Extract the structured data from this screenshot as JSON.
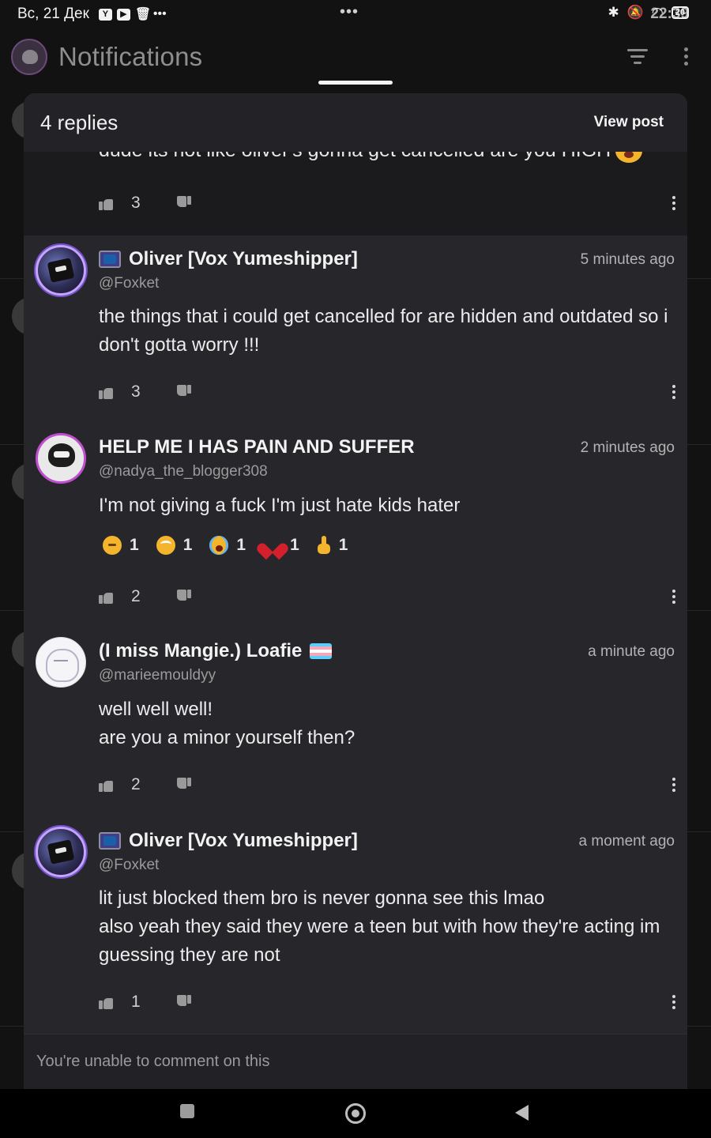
{
  "status_bar": {
    "time": "22:39",
    "date": "Вс, 21 Дек",
    "battery": "20"
  },
  "app": {
    "title": "Notifications"
  },
  "sheet": {
    "title": "4 replies",
    "view_post": "View post",
    "cropped_parent_text": "dude its not like oliver's gonna get cancelled are you HIGH",
    "parent_votes": "3",
    "unable_to_comment": "You're unable to comment on this"
  },
  "replies": [
    {
      "name": "Oliver [Vox Yumeshipper]",
      "handle": "@Foxket",
      "time": "5 minutes ago",
      "lines": [
        "the things that i could get cancelled for are hidden and outdated so i don't gotta worry !!!"
      ],
      "votes": "3"
    },
    {
      "name": "HELP ME I HAS PAIN AND SUFFER",
      "handle": "@nadya_the_blogger308",
      "time": "2 minutes ago",
      "lines": [
        "I'm not giving a fuck I'm just hate kids hater"
      ],
      "reactions": [
        {
          "emoji": "thinking-face",
          "count": "1"
        },
        {
          "emoji": "face-with-rolling-eyes",
          "count": "1"
        },
        {
          "emoji": "loudly-crying-face",
          "count": "1"
        },
        {
          "emoji": "broken-heart",
          "count": "1"
        },
        {
          "emoji": "pointing-up",
          "count": "1"
        }
      ],
      "votes": "2"
    },
    {
      "name": "(I miss Mangie.) Loafie",
      "handle": "@marieemouldyy",
      "time": "a minute ago",
      "lines": [
        "well well well!",
        "are you a minor yourself then?"
      ],
      "votes": "2"
    },
    {
      "name": "Oliver [Vox Yumeshipper]",
      "handle": "@Foxket",
      "time": "a moment ago",
      "lines": [
        "lit just blocked them bro is never gonna see this lmao",
        "also yeah they said they were a teen but with how they're acting im guessing they are not"
      ],
      "votes": "1"
    }
  ],
  "colors": {
    "background": "#121212",
    "sheet": "#1b1b1e",
    "reply_card": "#27272b",
    "accent_ring": "#c7a2ff"
  }
}
